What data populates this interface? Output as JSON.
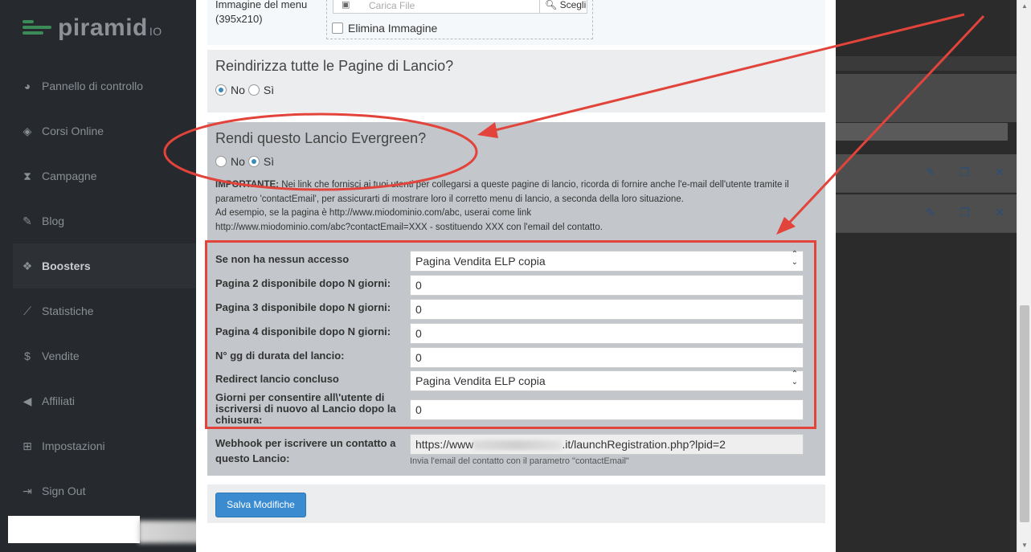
{
  "sidebar": {
    "logo_text": "piramid",
    "logo_suffix": "IO",
    "items": [
      {
        "label": "Pannello di controllo",
        "icon": "dashboard-icon"
      },
      {
        "label": "Corsi Online",
        "icon": "tag-icon"
      },
      {
        "label": "Campagne",
        "icon": "hourglass-icon"
      },
      {
        "label": "Blog",
        "icon": "edit-icon"
      },
      {
        "label": "Boosters",
        "icon": "cubes-icon"
      },
      {
        "label": "Statistiche",
        "icon": "chart-icon"
      },
      {
        "label": "Vendite",
        "icon": "dollar-icon"
      },
      {
        "label": "Affiliati",
        "icon": "megaphone-icon"
      },
      {
        "label": "Impostazioni",
        "icon": "settings-icon"
      },
      {
        "label": "Sign Out",
        "icon": "sign-out-icon"
      }
    ]
  },
  "modal": {
    "image": {
      "label": "Immagine del menu (395x210)",
      "placeholder": "Carica File",
      "choose_label": "Scegli",
      "delete_label": "Elimina Immagine"
    },
    "redirect": {
      "title": "Reindirizza tutte le Pagine di Lancio?",
      "no_label": "No",
      "yes_label": "Sì",
      "selected": "No"
    },
    "evergreen": {
      "title": "Rendi questo Lancio Evergreen?",
      "no_label": "No",
      "yes_label": "Sì",
      "selected": "Sì",
      "important_label": "IMPORTANTE:",
      "important_text": " Nei link che fornisci ai tuoi utenti per collegarsi a queste pagine di lancio, ricorda di fornire anche l'e-mail dell'utente tramite il parametro 'contactEmail', per assicurarti di mostrare loro il corretto menu di lancio, a seconda della loro situazione.",
      "example_line1": "Ad esempio, se la pagina è http://www.miodominio.com/abc, userai come link",
      "example_line2": "http://www.miodominio.com/abc?contactEmail=XXX - sostituendo XXX con l'email del contatto."
    },
    "fields": [
      {
        "label": "Se non ha nessun accesso",
        "value": "Pagina Vendita ELP copia"
      },
      {
        "label": "Pagina 2 disponibile dopo N giorni:",
        "value": "0"
      },
      {
        "label": "Pagina 3 disponibile dopo N giorni:",
        "value": "0"
      },
      {
        "label": "Pagina 4 disponibile dopo N giorni:",
        "value": "0"
      },
      {
        "label": "N° gg di durata del lancio:",
        "value": "0"
      },
      {
        "label": "Redirect lancio concluso",
        "value": "Pagina Vendita ELP copia"
      },
      {
        "label": "Giorni per consentire all\\'utente di iscriversi di nuovo al Lancio dopo la chiusura:",
        "value": "0"
      }
    ],
    "webhook": {
      "label": "Webhook per iscrivere un contatto a questo Lancio:",
      "url_start": "https://www",
      "url_end": ".it/launchRegistration.php?lpid=2",
      "help": "Invia l'email del contatto con il parametro \"contactEmail\""
    },
    "save_label": "Salva Modifiche"
  },
  "colors": {
    "sidebar_bg": "#262a2e",
    "accent_green": "#3c8a58",
    "primary_button": "#3a8bd0",
    "annotation_red": "#e2433a"
  }
}
